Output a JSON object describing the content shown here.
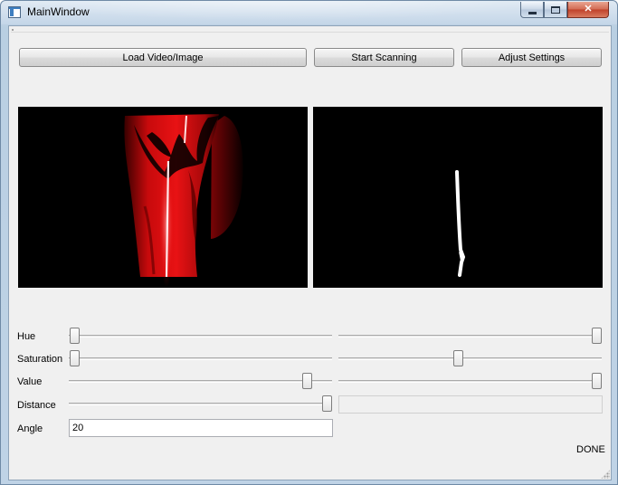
{
  "window": {
    "title": "MainWindow",
    "controls": {
      "minimize": "minimize",
      "maximize": "maximize",
      "close": "✕"
    }
  },
  "toolbar": {
    "load_label": "Load Video/Image",
    "scan_label": "Start Scanning",
    "settings_label": "Adjust Settings"
  },
  "views": {
    "source": {
      "icon": "video-frame-red-laser"
    },
    "mask": {
      "icon": "binary-mask-laser-line"
    }
  },
  "controls": {
    "hue": {
      "label": "Hue",
      "min_fraction": 0.0,
      "max_fraction": 1.0
    },
    "saturation": {
      "label": "Saturation",
      "min_fraction": 0.0,
      "max_fraction": 0.45
    },
    "value": {
      "label": "Value",
      "min_fraction": 0.92,
      "max_fraction": 1.0
    },
    "distance": {
      "label": "Distance",
      "fraction": 1.0,
      "secondary_value": ""
    },
    "angle": {
      "label": "Angle",
      "value": "20"
    }
  },
  "status": {
    "text": "DONE"
  },
  "colors": {
    "laser_red": "#e10f12",
    "mask_white": "#ffffff",
    "background": "#f0f0f0"
  }
}
